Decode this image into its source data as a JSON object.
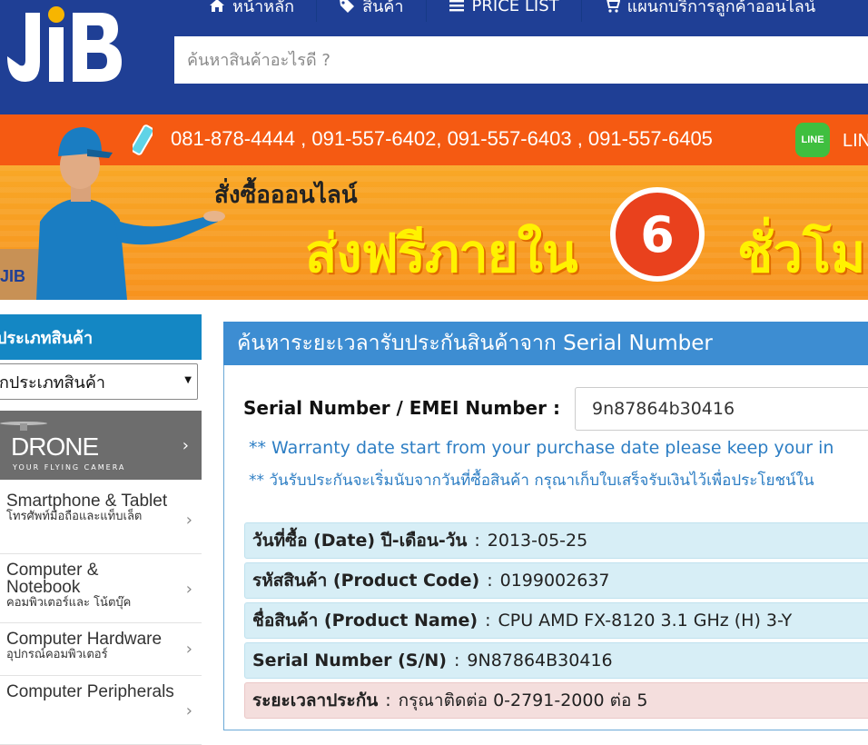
{
  "header": {
    "nav": [
      {
        "label": "หน้าหลัก",
        "icon": "home-icon"
      },
      {
        "label": "สินค้า",
        "icon": "tag-icon"
      },
      {
        "label": "PRICE LIST",
        "icon": "list-icon"
      },
      {
        "label": "แผนกบริการลูกค้าออนไลน์",
        "icon": "cart-icon"
      }
    ],
    "search_placeholder": "ค้นหาสินค้าอะไรดี ?",
    "logo_text": "JIB"
  },
  "phonebar": {
    "phones": "081-878-4444 , 091-557-6402, 091-557-6403 , 091-557-6405",
    "line_label": "LIN",
    "line_icon_text": "LINE"
  },
  "banner": {
    "line1": "สั่งซื้อออนไลน์",
    "line2a": "ส่งฟรีภายใน",
    "clock_number": "6",
    "line2b": "ชั่วโมง",
    "mascot_box_text": "JIB",
    "accent": "#f7921e"
  },
  "sidebar": {
    "header": "ประเภทสินค้า",
    "select_value": "กประเภทสินค้า",
    "drone": {
      "title": "DRONE",
      "subtitle": "YOUR FLYING CAMERA"
    },
    "categories": [
      {
        "en": "Smartphone & Tablet",
        "th": "โทรศัพท์มือถือและแท็บเล็ต"
      },
      {
        "en": "Computer & Notebook",
        "th": "คอมพิวเตอร์และ โน้ตบุ๊ค"
      },
      {
        "en": "Computer Hardware",
        "th": "อุปกรณ์คอมพิวเตอร์"
      },
      {
        "en": "Computer Peripherals",
        "th": ""
      }
    ]
  },
  "main": {
    "title": "ค้นหาระยะเวลารับประกันสินค้าจาก Serial Number",
    "serial_label": "Serial Number / EMEI Number :",
    "serial_value": "9n87864b30416",
    "note_en": "** Warranty date start from your purchase date please keep your in",
    "note_th": "** วันรับประกันจะเริ่มนับจากวันที่ซื้อสินค้า กรุณาเก็บใบเสร็จรับเงินไว้เพื่อประโยชน์ใน",
    "results": [
      {
        "label": "วันที่ซื้อ (Date) ปี-เดือน-วัน",
        "value": "2013-05-25"
      },
      {
        "label": "รหัสสินค้า (Product Code)",
        "value": "0199002637"
      },
      {
        "label": "ชื่อสินค้า (Product Name)",
        "value": "CPU AMD FX-8120 3.1 GHz (H) 3-Y"
      },
      {
        "label": "Serial Number (S/N)",
        "value": "9N87864B30416"
      }
    ],
    "warranty": {
      "label": "ระยะเวลาประกัน",
      "value": "กรุณาติดต่อ 0-2791-2000 ต่อ 5"
    },
    "separator": ":"
  },
  "colors": {
    "header_bg": "#1f3f95",
    "phonebar_bg": "#f55a12",
    "panel_head": "#3d8dd2",
    "row_bg": "#d7eef6",
    "warn_bg": "#f4dedd"
  }
}
